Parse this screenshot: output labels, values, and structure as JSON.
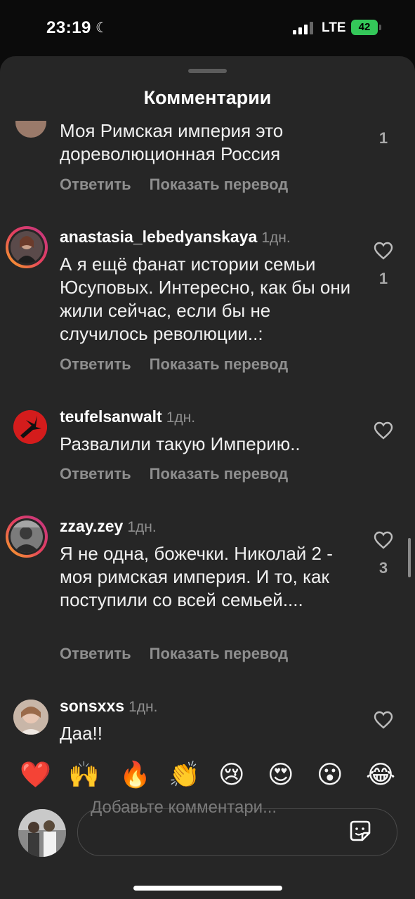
{
  "status": {
    "time": "23:19",
    "network": "LTE",
    "battery": "42"
  },
  "sheet": {
    "title": "Комментарии"
  },
  "comments": [
    {
      "username": "",
      "time": "",
      "text": "Моя Римская империя это дореволюционная Россия",
      "reply": "Ответить",
      "translate": "Показать перевод",
      "likes": "1"
    },
    {
      "username": "anastasia_lebedyanskaya",
      "time": "1дн.",
      "text": "А я ещё фанат истории семьи Юсуповых. Интересно, как бы они жили сейчас, если бы не случилось революции..:",
      "reply": "Ответить",
      "translate": "Показать перевод",
      "likes": "1"
    },
    {
      "username": "teufelsanwalt",
      "time": "1дн.",
      "text": "Развалили такую Империю..",
      "reply": "Ответить",
      "translate": "Показать перевод",
      "likes": ""
    },
    {
      "username": "zzay.zey",
      "time": "1дн.",
      "text": "Я не одна, божечки. Николай 2 - моя римская империя. И то, как поступили со всей семьей....",
      "reply": "Ответить",
      "translate": "Показать перевод",
      "likes": "3"
    },
    {
      "username": "sonsxxs",
      "time": "1дн.",
      "text": "Даа!!",
      "reply": "",
      "translate": "",
      "likes": ""
    }
  ],
  "emojis": [
    "❤️",
    "🙌",
    "🔥",
    "👏",
    "😢",
    "😍",
    "😮",
    "😂"
  ],
  "composer": {
    "placeholder": "Добавьте комментари..."
  },
  "icons": [
    "moon-icon",
    "signal-icon",
    "heart-icon",
    "sticker-icon"
  ]
}
